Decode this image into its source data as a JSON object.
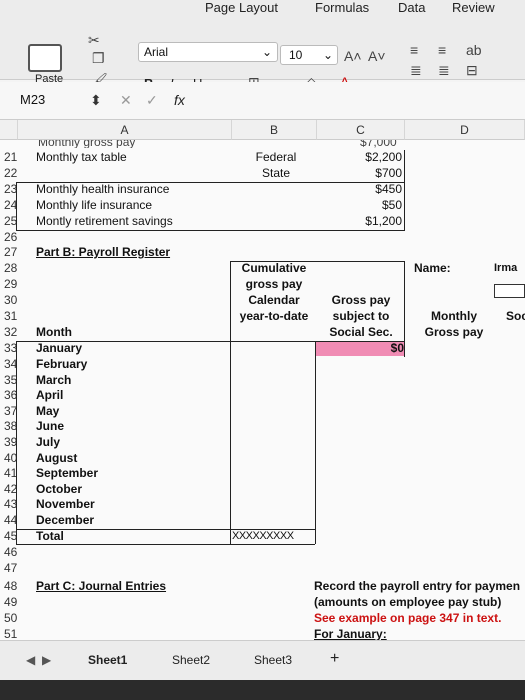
{
  "ribbon": {
    "tabs": [
      "Page Layout",
      "Formulas",
      "Data",
      "Review"
    ],
    "paste_label": "Paste",
    "font_name": "Arial",
    "font_size": "10",
    "bold": "B",
    "italic": "I",
    "underline": "U"
  },
  "formula_bar": {
    "cell_ref": "M23",
    "fx": "fx"
  },
  "columns": [
    "A",
    "B",
    "C",
    "D"
  ],
  "rows": {
    "r20_partial": "Monthly gross pay",
    "r21": {
      "num": "21",
      "a": "Monthly tax table",
      "b": "Federal",
      "c": "$2,200"
    },
    "r22": {
      "num": "22",
      "b": "State",
      "c": "$700"
    },
    "r23": {
      "num": "23",
      "a": "Monthly health insurance",
      "c": "$450"
    },
    "r24": {
      "num": "24",
      "a": "Monthly life insurance",
      "c": "$50"
    },
    "r25": {
      "num": "25",
      "a": "Montly retirement savings",
      "c": "$1,200"
    },
    "r26": {
      "num": "26"
    },
    "r27": {
      "num": "27",
      "a": "Part B: Payroll Register"
    },
    "r28": {
      "num": "28",
      "b": "Cumulative",
      "d": "Name:",
      "e": "Irma"
    },
    "r29": {
      "num": "29",
      "b": "gross pay"
    },
    "r30": {
      "num": "30",
      "b": "Calendar",
      "c": "Gross pay"
    },
    "r31": {
      "num": "31",
      "b": "year-to-date",
      "c": "subject to",
      "d": "Monthly",
      "e": "Soc"
    },
    "r32": {
      "num": "32",
      "a": "Month",
      "c": "Social Sec.",
      "d": "Gross pay"
    },
    "r33": {
      "num": "33",
      "a": "January",
      "c": "$0"
    },
    "months": [
      {
        "num": "34",
        "a": "February"
      },
      {
        "num": "35",
        "a": "March"
      },
      {
        "num": "36",
        "a": "April"
      },
      {
        "num": "37",
        "a": "May"
      },
      {
        "num": "38",
        "a": "June"
      },
      {
        "num": "39",
        "a": "July"
      },
      {
        "num": "40",
        "a": "August"
      },
      {
        "num": "41",
        "a": "September"
      },
      {
        "num": "42",
        "a": "October"
      },
      {
        "num": "43",
        "a": "November"
      },
      {
        "num": "44",
        "a": "December"
      }
    ],
    "r45": {
      "num": "45",
      "a": "Total",
      "b": "XXXXXXXXX"
    },
    "r46": {
      "num": "46"
    },
    "r47": {
      "num": "47"
    },
    "r48": {
      "num": "48",
      "a": "Part C: Journal Entries",
      "c": "Record the payroll entry for paymen"
    },
    "r49": {
      "num": "49",
      "c": "(amounts on employee pay stub)"
    },
    "r50": {
      "num": "50",
      "c": "See example on page 347 in text."
    },
    "r51": {
      "num": "51",
      "c": "For January:"
    }
  },
  "sheet_tabs": [
    "Sheet1",
    "Sheet2",
    "Sheet3"
  ],
  "add_sheet": "+",
  "colors": {
    "pink": "#f08cb4",
    "red_text": "#cc1111"
  }
}
